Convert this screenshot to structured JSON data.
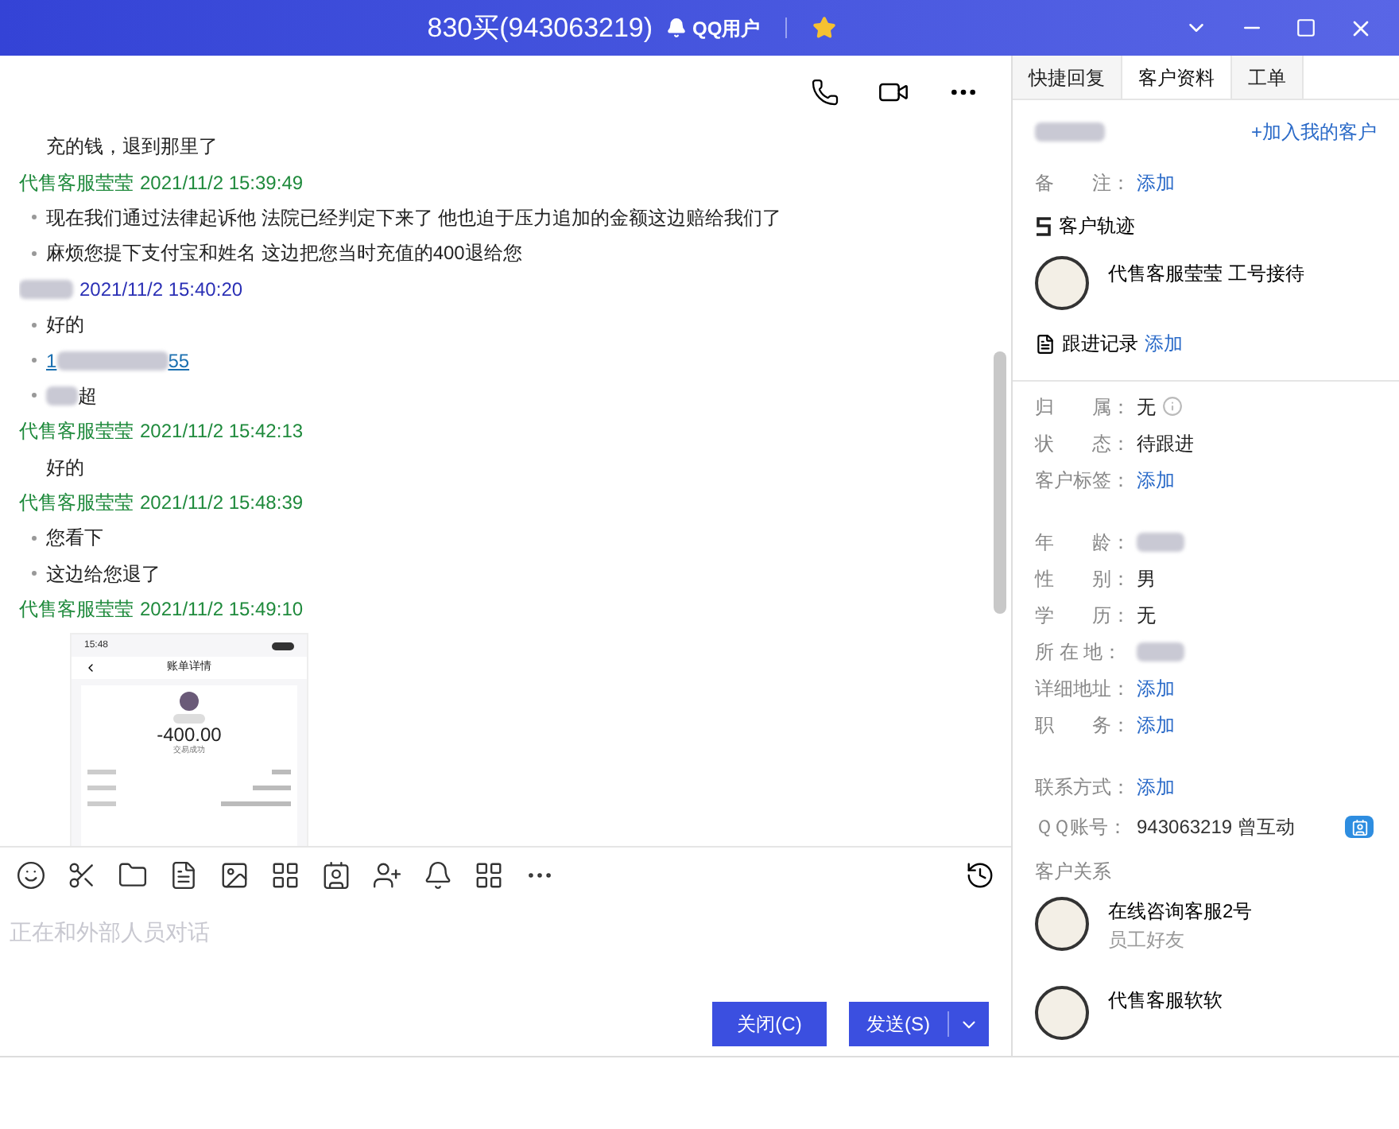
{
  "window": {
    "title": "830买(943063219)",
    "account_type": "QQ用户"
  },
  "chat": {
    "messages": [
      {
        "kind": "text",
        "bullet": false,
        "text": "充的钱，退到那里了"
      },
      {
        "kind": "header",
        "color": "#1f8a3c",
        "sender": "代售客服莹莹",
        "time": "2021/11/2 15:39:49"
      },
      {
        "kind": "text",
        "bullet": true,
        "text": "现在我们通过法律起诉他  法院已经判定下来了  他也迫于压力追加的金额这边赔给我们了"
      },
      {
        "kind": "text",
        "bullet": true,
        "text": "麻烦您提下支付宝和姓名  这边把您当时充值的400退给您"
      },
      {
        "kind": "header",
        "color": "#2a2fb5",
        "time": "2021/11/2 15:40:20"
      },
      {
        "kind": "text",
        "bullet": true,
        "text": "好的"
      },
      {
        "kind": "link",
        "bullet": true,
        "start": "1",
        "end": "55"
      },
      {
        "kind": "masked",
        "bullet": true,
        "end": "超"
      },
      {
        "kind": "header",
        "color": "#1f8a3c",
        "sender": "代售客服莹莹",
        "time": "2021/11/2 15:42:13"
      },
      {
        "kind": "text",
        "bullet": false,
        "text": "好的"
      },
      {
        "kind": "header",
        "color": "#1f8a3c",
        "sender": "代售客服莹莹",
        "time": "2021/11/2 15:48:39"
      },
      {
        "kind": "text",
        "bullet": true,
        "text": "您看下"
      },
      {
        "kind": "text",
        "bullet": true,
        "text": "这边给您退了"
      },
      {
        "kind": "header",
        "color": "#1f8a3c",
        "sender": "代售客服莹莹",
        "time": "2021/11/2 15:49:10"
      },
      {
        "kind": "image",
        "status_time": "15:48",
        "page_title": "账单详情",
        "amount": "-400.00",
        "result": "交易成功"
      }
    ],
    "input": {
      "placeholder": "正在和外部人员对话"
    },
    "buttons": {
      "close": "关闭(C)",
      "send": "发送(S)"
    }
  },
  "sidebar": {
    "tabs": [
      {
        "label": "快捷回复",
        "selected": false
      },
      {
        "label": "客户资料",
        "selected": true
      },
      {
        "label": "工单",
        "selected": false
      }
    ],
    "add_customer": "+加入我的客户",
    "remark": {
      "label": "备　　注：",
      "action": "添加"
    },
    "track_title": "客户轨迹",
    "track_entry": "代售客服莹莹  工号接待",
    "follow_up": {
      "label": "跟进记录",
      "action": "添加"
    },
    "fields": [
      {
        "kind": "value",
        "label": "归　　属：",
        "value": "无",
        "info": true
      },
      {
        "kind": "value",
        "label": "状　　态：",
        "value": "待跟进",
        "info": false
      },
      {
        "kind": "action",
        "label": "客户标签：",
        "value": "添加"
      },
      {
        "kind": "gap"
      },
      {
        "kind": "masked",
        "label": "年　　龄："
      },
      {
        "kind": "value",
        "label": "性　　别：",
        "value": "男",
        "info": false
      },
      {
        "kind": "value",
        "label": "学　　历：",
        "value": "无",
        "info": false
      },
      {
        "kind": "masked",
        "label": "所 在 地："
      },
      {
        "kind": "action",
        "label": "详细地址：",
        "value": "添加"
      },
      {
        "kind": "action",
        "label": "职　　务：",
        "value": "添加"
      },
      {
        "kind": "gap"
      },
      {
        "kind": "action",
        "label": "联系方式：",
        "value": "添加"
      },
      {
        "kind": "qq",
        "label": "ＱＱ账号：",
        "value": "943063219 曾互动"
      }
    ],
    "relations_title": "客户关系",
    "relations": [
      {
        "name": "在线咨询客服2号",
        "note": "员工好友"
      },
      {
        "name": "代售客服软软"
      }
    ]
  }
}
